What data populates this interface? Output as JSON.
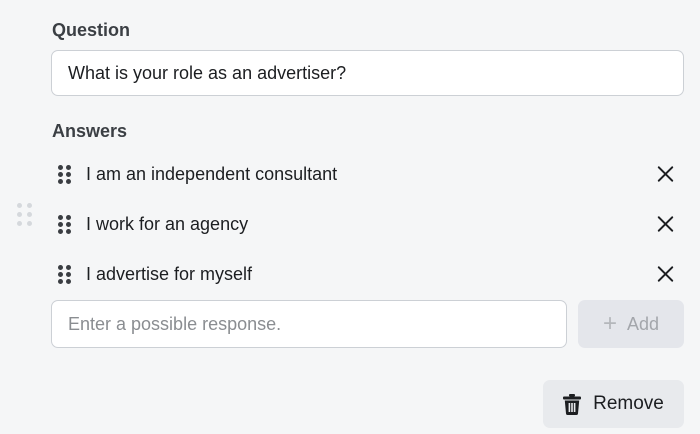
{
  "question": {
    "label": "Question",
    "value": "What is your role as an advertiser?"
  },
  "answers": {
    "label": "Answers",
    "items": [
      {
        "text": "I am an independent consultant"
      },
      {
        "text": "I work for an agency"
      },
      {
        "text": "I advertise for myself"
      }
    ]
  },
  "new_response": {
    "placeholder": "Enter a possible response.",
    "value": ""
  },
  "add_button": {
    "icon": "plus-icon",
    "label": "Add",
    "disabled": true
  },
  "remove_button": {
    "icon": "trash-icon",
    "label": "Remove"
  },
  "colors": {
    "background": "#f5f6f7",
    "disabled_button": "#e4e6eb",
    "secondary_button": "#e8eaed",
    "border": "#ccd0d5"
  }
}
